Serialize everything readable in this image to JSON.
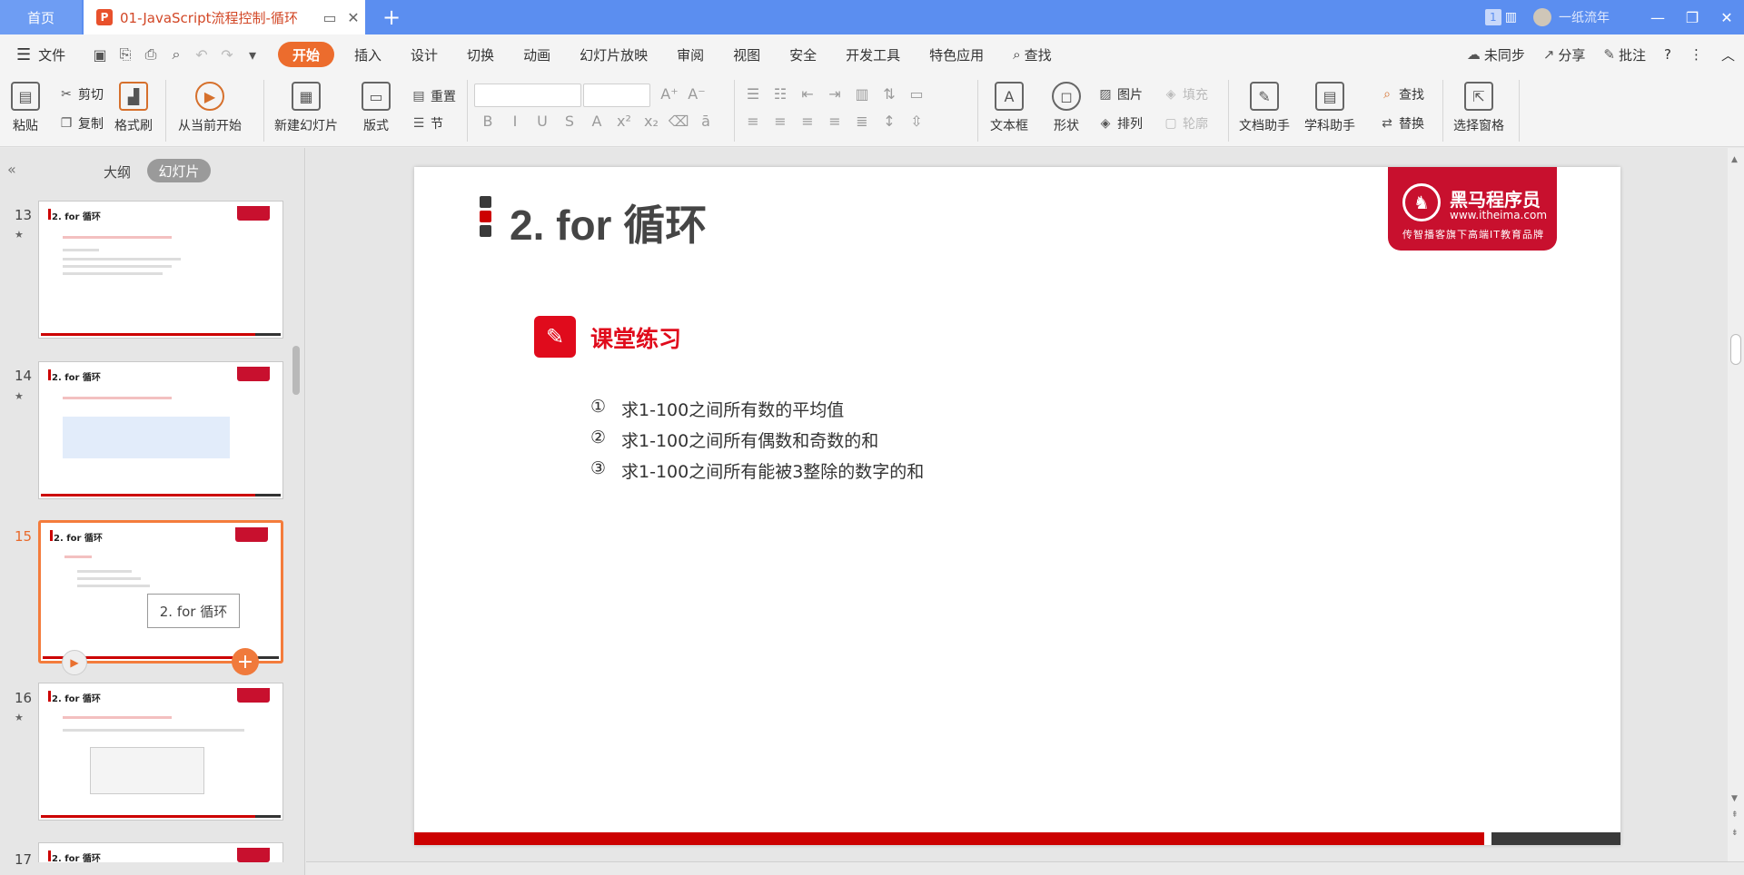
{
  "window": {
    "home_tab": "首页",
    "doc_tab_title": "01-JavaScript流程控制-循环",
    "page_count_badge": "1",
    "user_name": "一纸流年",
    "window_buttons": [
      "—",
      "❐",
      "✕"
    ]
  },
  "menu": {
    "file_label": "文件",
    "tabs": [
      "开始",
      "插入",
      "设计",
      "切换",
      "动画",
      "幻灯片放映",
      "审阅",
      "视图",
      "安全",
      "开发工具",
      "特色应用"
    ],
    "search_label": "查找",
    "sync_label": "未同步",
    "share_label": "分享",
    "annotate_label": "批注"
  },
  "ribbon": {
    "paste": "粘贴",
    "cut": "剪切",
    "copy": "复制",
    "format_painter": "格式刷",
    "from_current": "从当前开始",
    "new_slide": "新建幻灯片",
    "layout": "版式",
    "reset": "重置",
    "section": "节",
    "textbox": "文本框",
    "shape": "形状",
    "picture": "图片",
    "fill": "填充",
    "arrange": "排列",
    "outline": "轮廓",
    "doc_assistant": "文档助手",
    "subject_assistant": "学科助手",
    "find": "查找",
    "replace": "替换",
    "select_pane": "选择窗格"
  },
  "panel": {
    "outline_tab": "大纲",
    "slides_tab": "幻灯片",
    "tooltip": "2. for 循环",
    "thumbnails": [
      {
        "num": "13",
        "title": "2. for 循环"
      },
      {
        "num": "14",
        "title": "2. for 循环"
      },
      {
        "num": "15",
        "title": "2. for 循环"
      },
      {
        "num": "16",
        "title": "2. for 循环"
      },
      {
        "num": "17",
        "title": "2. for 循环"
      }
    ]
  },
  "slide": {
    "title": "2. for 循环",
    "logo_name": "黑马程序员",
    "logo_url": "www.itheima.com",
    "logo_slogan": "传智播客旗下高端IT教育品牌",
    "exercise_title": "课堂练习",
    "items": [
      {
        "num": "①",
        "text": "求1-100之间所有数的平均值"
      },
      {
        "num": "②",
        "text": "求1-100之间所有偶数和奇数的和"
      },
      {
        "num": "③",
        "text": "求1-100之间所有能被3整除的数字的和"
      }
    ]
  },
  "colors": {
    "accent": "#ec6c2d",
    "titlebar": "#5b8ef0",
    "brand_red": "#c8102e",
    "exercise_red": "#e00b1c"
  }
}
